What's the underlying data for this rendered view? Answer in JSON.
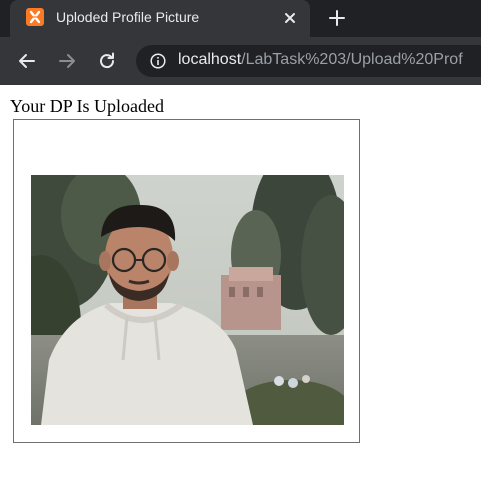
{
  "browser": {
    "tab_title": "Uploded Profile Picture",
    "url_host": "localhost",
    "url_path": "/LabTask%203/Upload%20Prof",
    "favicon": "xampp-icon",
    "icons": [
      "close-icon",
      "plus-icon",
      "back-arrow-icon",
      "forward-arrow-icon",
      "reload-icon",
      "info-icon"
    ]
  },
  "page": {
    "heading": "Your DP Is Uploaded",
    "image_alt": "Profile picture"
  },
  "colors": {
    "tabstrip": "#202124",
    "toolbar": "#35363a",
    "favicon": "#fb7a24",
    "frame_border": "#6f6f6f"
  }
}
